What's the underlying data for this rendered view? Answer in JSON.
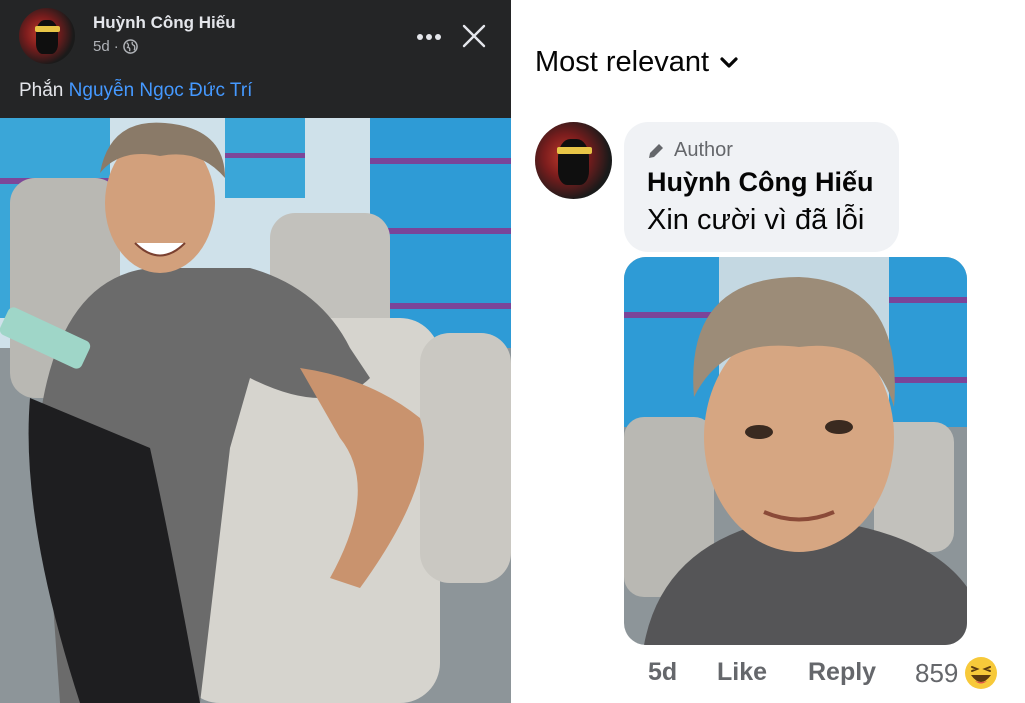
{
  "post": {
    "author": "Huỳnh Công Hiếu",
    "time": "5d",
    "separator": "·",
    "caption_prefix": "Phắn ",
    "tagged_user": "Nguyễn Ngọc Đức Trí",
    "more_icon": "more-horizontal-icon",
    "close_icon": "close-icon",
    "privacy_icon": "globe-icon"
  },
  "comments": {
    "sort_label": "Most relevant",
    "sort_icon": "chevron-down-icon",
    "items": [
      {
        "badge": "Author",
        "badge_icon": "pencil-icon",
        "author": "Huỳnh Công Hiếu",
        "text": "Xin cười vì đã lỗi",
        "time": "5d",
        "like_label": "Like",
        "reply_label": "Reply",
        "reaction_count": "859",
        "reaction_icon": "haha-emoji-icon"
      }
    ]
  },
  "colors": {
    "dark_panel": "#242526",
    "link_blue": "#4599ff",
    "bubble_bg": "#f0f2f5",
    "muted_text": "#65676b"
  }
}
